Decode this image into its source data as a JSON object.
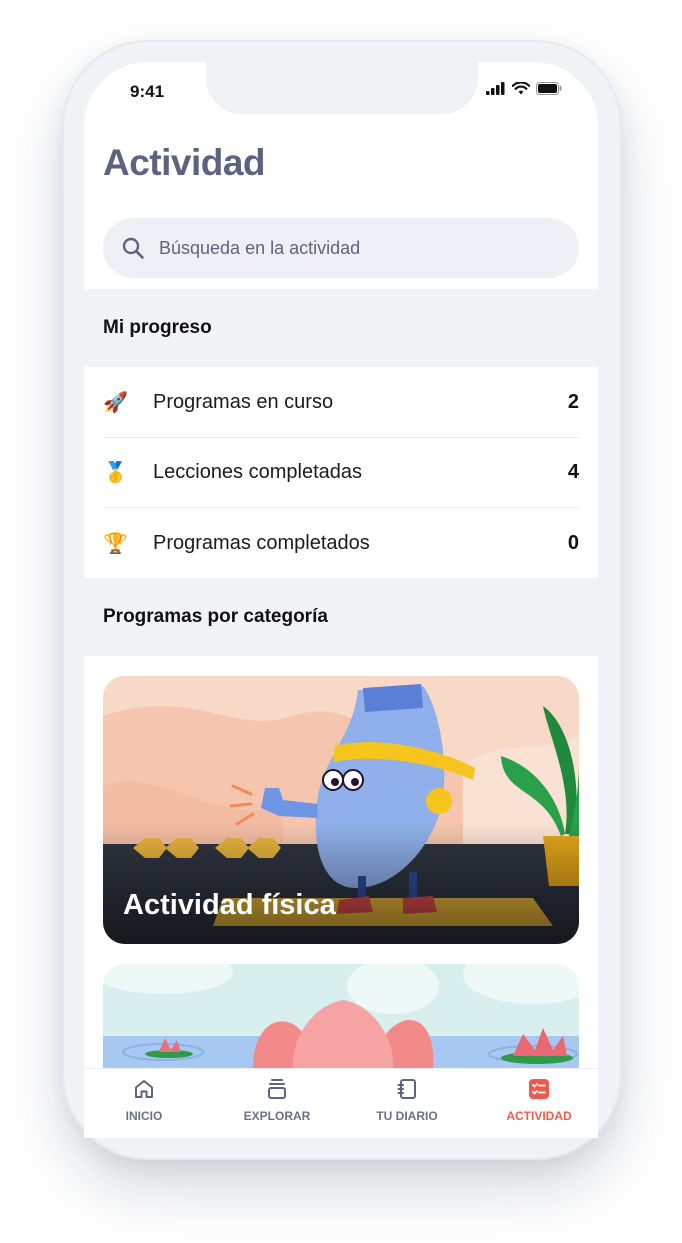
{
  "status_bar": {
    "time": "9:41"
  },
  "page": {
    "title": "Actividad"
  },
  "search": {
    "placeholder": "Búsqueda en la actividad"
  },
  "progress": {
    "heading": "Mi progreso",
    "items": [
      {
        "icon": "rocket-icon",
        "emoji": "🚀",
        "label": "Programas en curso",
        "value": "2"
      },
      {
        "icon": "medal-icon",
        "emoji": "🥇",
        "label": "Lecciones completadas",
        "value": "4"
      },
      {
        "icon": "trophy-icon",
        "emoji": "🏆",
        "label": "Programas completados",
        "value": "0"
      }
    ]
  },
  "categories": {
    "heading": "Programas por categoría",
    "cards": [
      {
        "title": "Actividad física"
      },
      {
        "title": ""
      }
    ]
  },
  "tabbar": {
    "tabs": [
      {
        "label": "INICIO",
        "icon": "home-icon",
        "active": false
      },
      {
        "label": "EXPLORAR",
        "icon": "stack-icon",
        "active": false
      },
      {
        "label": "TU DIARIO",
        "icon": "journal-icon",
        "active": false
      },
      {
        "label": "ACTIVIDAD",
        "icon": "checklist-icon",
        "active": true
      }
    ]
  },
  "colors": {
    "accent": "#f05a4a",
    "title": "#5b6380",
    "band": "#f1f3f7"
  }
}
